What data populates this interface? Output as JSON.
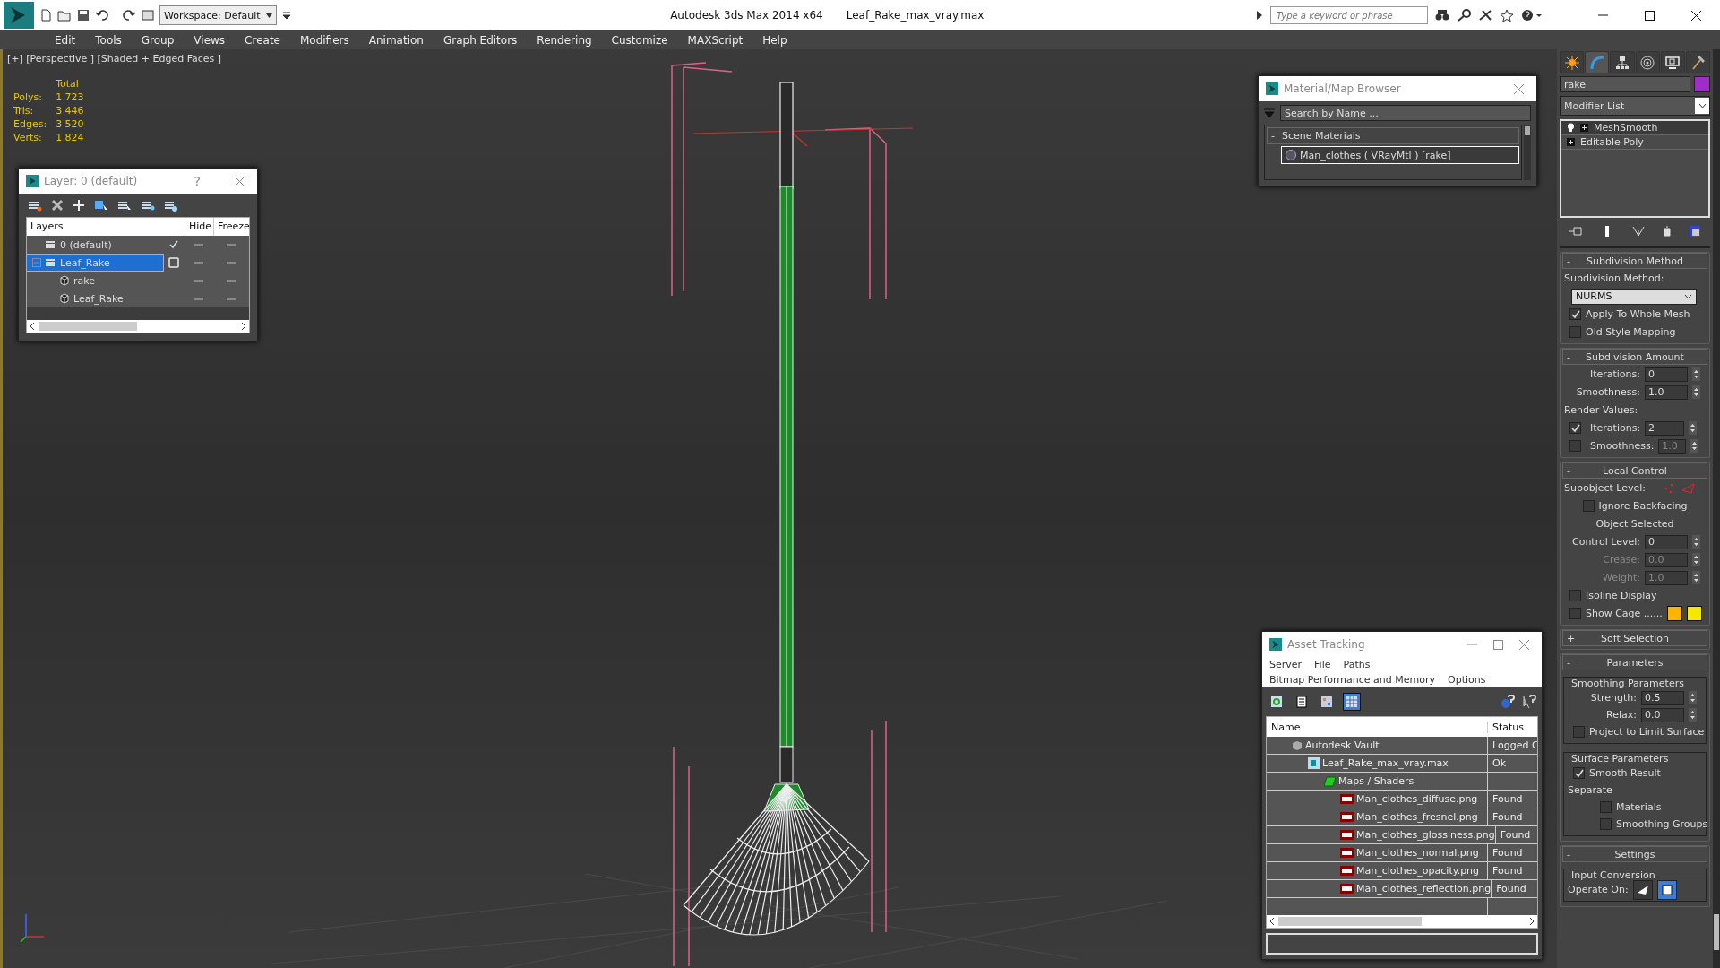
{
  "title_bar": {
    "workspace": "Workspace: Default",
    "app_title": "Autodesk 3ds Max  2014 x64",
    "file_name": "Leaf_Rake_max_vray.max",
    "search": {
      "placeholder": "Type a keyword or phrase"
    }
  },
  "menu": [
    "Edit",
    "Tools",
    "Group",
    "Views",
    "Create",
    "Modifiers",
    "Animation",
    "Graph Editors",
    "Rendering",
    "Customize",
    "MAXScript",
    "Help"
  ],
  "viewport": {
    "label": "[+] [Perspective ] [Shaded + Edged Faces ]",
    "stats": {
      "header": "Total",
      "rows": [
        {
          "label": "Polys:",
          "value": "1 723"
        },
        {
          "label": "Tris:",
          "value": "3 446"
        },
        {
          "label": "Edges:",
          "value": "3 520"
        },
        {
          "label": "Verts:",
          "value": "1 824"
        }
      ]
    }
  },
  "layer_dialog": {
    "title": "Layer: 0 (default)",
    "help": "?",
    "columns": [
      "Layers",
      "Hide",
      "Freeze"
    ],
    "layers": [
      {
        "name": "0 (default)",
        "kind": "layer",
        "selected": false,
        "active": true,
        "hidden": false,
        "frozen": false
      },
      {
        "name": "Leaf_Rake",
        "kind": "layer",
        "selected": true,
        "active": false,
        "hidden": false,
        "frozen": false,
        "expanded": true,
        "children": [
          {
            "name": "rake",
            "kind": "object",
            "selected": false,
            "hidden": false,
            "frozen": false
          },
          {
            "name": "Leaf_Rake",
            "kind": "object",
            "selected": false,
            "hidden": false,
            "frozen": false
          }
        ]
      }
    ]
  },
  "material_browser": {
    "title": "Material/Map Browser",
    "search": {
      "placeholder": "Search by Name ..."
    },
    "groups": [
      {
        "toggle": "-",
        "label": "Scene Materials",
        "items": [
          {
            "name": "Man_clothes  ( VRayMtl ) [rake]",
            "selected": true
          }
        ]
      }
    ]
  },
  "asset_tracking": {
    "title": "Asset Tracking",
    "menu_rows": [
      [
        "Server",
        "File",
        "Paths"
      ],
      [
        "Bitmap Performance and Memory",
        "Options"
      ]
    ],
    "toolbar": [
      {
        "kind": "refresh",
        "selected": false
      },
      {
        "kind": "list",
        "selected": false
      },
      {
        "kind": "thumbnails",
        "selected": false
      },
      {
        "kind": "table",
        "selected": true
      }
    ],
    "columns": [
      "Name",
      "Status"
    ],
    "rows": [
      {
        "name": "Autodesk Vault",
        "status": "Logged C",
        "kind": "vault",
        "children": [
          {
            "name": "Leaf_Rake_max_vray.max",
            "status": "Ok",
            "kind": "scene",
            "children": [
              {
                "name": "Maps / Shaders",
                "kind": "folder",
                "children": [
                  {
                    "name": "Man_clothes_diffuse.png",
                    "status": "Found",
                    "kind": "png"
                  },
                  {
                    "name": "Man_clothes_fresnel.png",
                    "status": "Found",
                    "kind": "png"
                  },
                  {
                    "name": "Man_clothes_glossiness.png",
                    "status": "Found",
                    "kind": "png"
                  },
                  {
                    "name": "Man_clothes_normal.png",
                    "status": "Found",
                    "kind": "png"
                  },
                  {
                    "name": "Man_clothes_opacity.png",
                    "status": "Found",
                    "kind": "png"
                  },
                  {
                    "name": "Man_clothes_reflection.png",
                    "status": "Found",
                    "kind": "png"
                  }
                ]
              }
            ]
          }
        ]
      }
    ]
  },
  "command_panel": {
    "tabs": [
      {
        "kind": "create",
        "selected": false
      },
      {
        "kind": "modify",
        "selected": true
      },
      {
        "kind": "hierarchy",
        "selected": false
      },
      {
        "kind": "motion",
        "selected": false
      },
      {
        "kind": "display",
        "selected": false
      },
      {
        "kind": "utilities",
        "selected": false
      }
    ],
    "object_name": "rake",
    "modifier_list": "Modifier List",
    "stack": [
      {
        "name": "MeshSmooth",
        "kind": "modifier",
        "selected": true
      },
      {
        "name": "Editable Poly",
        "kind": "base",
        "selected": false
      }
    ],
    "rollouts": [
      {
        "toggle": "-",
        "title": "Subdivision Method",
        "rows": [
          {
            "kind": "label",
            "text": "Subdivision Method:"
          },
          {
            "kind": "dropdown",
            "value": "NURMS"
          },
          {
            "kind": "checkbox",
            "label": "Apply To Whole Mesh",
            "checked": true
          },
          {
            "kind": "checkbox",
            "label": "Old Style Mapping",
            "checked": false
          }
        ]
      },
      {
        "toggle": "-",
        "title": "Subdivision Amount",
        "rows": [
          {
            "kind": "spinner",
            "label": "Iterations:",
            "value": "0",
            "disabled": false
          },
          {
            "kind": "spinner",
            "label": "Smoothness:",
            "value": "1.0",
            "disabled": false
          },
          {
            "kind": "label",
            "text": "Render Values:"
          },
          {
            "kind": "check_spinner",
            "label": "Iterations:",
            "value": "2",
            "checked": true,
            "disabled": false
          },
          {
            "kind": "check_spinner",
            "label": "Smoothness:",
            "value": "1.0",
            "checked": false,
            "disabled": true
          }
        ]
      },
      {
        "toggle": "-",
        "title": "Local Control",
        "rows": [
          {
            "kind": "subobject",
            "label": "Subobject Level:"
          },
          {
            "kind": "center_checkbox",
            "label": "Ignore Backfacing",
            "checked": false
          },
          {
            "kind": "center_label",
            "text": "Object Selected"
          },
          {
            "kind": "spinner",
            "label": "Control Level:",
            "value": "0",
            "disabled": false
          },
          {
            "kind": "spinner",
            "label": "Crease:",
            "value": "0.0",
            "disabled": true
          },
          {
            "kind": "spinner",
            "label": "Weight:",
            "value": "1.0",
            "disabled": true
          },
          {
            "kind": "checkbox",
            "label": "Isoline Display",
            "checked": false
          },
          {
            "kind": "cage",
            "label": "Show Cage ......",
            "checked": false
          }
        ]
      },
      {
        "toggle": "+",
        "title": "Soft Selection"
      },
      {
        "toggle": "-",
        "title": "Parameters",
        "rows": [
          {
            "kind": "group",
            "title": "Smoothing Parameters",
            "rows": [
              {
                "kind": "spinner",
                "label": "Strength:",
                "value": "0.5",
                "disabled": false
              },
              {
                "kind": "spinner",
                "label": "Relax:",
                "value": "0.0",
                "disabled": false
              },
              {
                "kind": "checkbox",
                "label": "Project to Limit Surface",
                "checked": false
              }
            ]
          },
          {
            "kind": "group",
            "title": "Surface Parameters",
            "rows": [
              {
                "kind": "checkbox",
                "label": "Smooth Result",
                "checked": true
              },
              {
                "kind": "label",
                "text": "Separate"
              },
              {
                "kind": "sub_checkbox",
                "label": "Materials",
                "checked": false
              },
              {
                "kind": "sub_checkbox",
                "label": "Smoothing Groups",
                "checked": false
              }
            ]
          }
        ]
      },
      {
        "toggle": "-",
        "title": "Settings",
        "rows": [
          {
            "kind": "group",
            "title": "Input Conversion",
            "rows": [
              {
                "kind": "operate_on",
                "label": "Operate On:",
                "buttons": [
                  {
                    "kind": "triangle",
                    "selected": false
                  },
                  {
                    "kind": "polygon",
                    "selected": true
                  }
                ]
              }
            ]
          }
        ]
      }
    ]
  }
}
